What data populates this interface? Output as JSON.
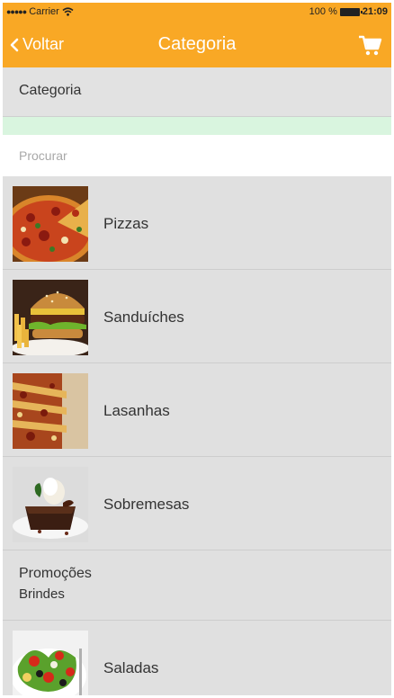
{
  "status_bar": {
    "carrier": "Carrier",
    "battery": "100 %",
    "time": "21:09"
  },
  "nav": {
    "back_label": "Voltar",
    "title": "Categoria",
    "cart_icon": "cart-icon"
  },
  "header": {
    "label": "Categoria"
  },
  "search": {
    "placeholder": "Procurar"
  },
  "categories": [
    {
      "label": "Pizzas",
      "image": "pizza"
    },
    {
      "label": "Sanduíches",
      "image": "burger"
    },
    {
      "label": "Lasanhas",
      "image": "lasagna"
    },
    {
      "label": "Sobremesas",
      "image": "dessert"
    },
    {
      "label_line1": "Promoções",
      "label_line2": "Brindes"
    },
    {
      "label": "Saladas",
      "image": "salad"
    }
  ],
  "colors": {
    "accent": "#f9a825",
    "background": "#e0e0e0",
    "highlight": "#d9f5df"
  }
}
